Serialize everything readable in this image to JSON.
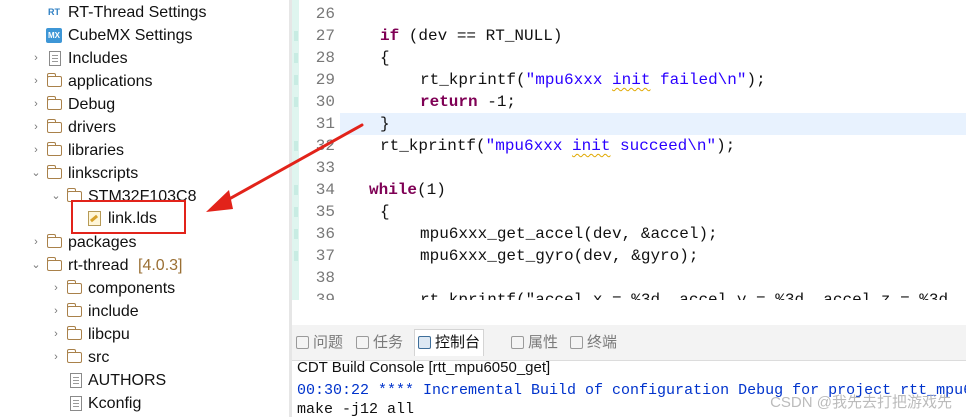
{
  "tree": {
    "rt_thread_settings": "RT-Thread Settings",
    "rt_icon_text": "RT",
    "cubemx_settings": "CubeMX Settings",
    "mx_icon_text": "MX",
    "includes": "Includes",
    "applications": "applications",
    "debug": "Debug",
    "drivers": "drivers",
    "libraries": "libraries",
    "linkscripts": "linkscripts",
    "stm32": "STM32F103C8",
    "link_lds": "link.lds",
    "packages": "packages",
    "rt_thread": "rt-thread",
    "rt_thread_version": "[4.0.3]",
    "components": "components",
    "include": "include",
    "libcpu": "libcpu",
    "src": "src",
    "authors": "AUTHORS",
    "kconfig": "Kconfig"
  },
  "editor": {
    "lines": [
      {
        "n": "26"
      },
      {
        "n": "27",
        "a": "if",
        "b": " (dev == RT_NULL)"
      },
      {
        "n": "28",
        "a": "{"
      },
      {
        "n": "29",
        "a": "rt_kprintf(",
        "s1": "\"mpu6xxx ",
        "s2": "init",
        "s3": " failed\\n\"",
        "b": ");"
      },
      {
        "n": "30",
        "a": "return",
        "b": " -1;"
      },
      {
        "n": "31",
        "a": "}"
      },
      {
        "n": "32",
        "a": "rt_kprintf(",
        "s1": "\"mpu6xxx ",
        "s2": "init",
        "s3": " succeed\\n\"",
        "b": ");"
      },
      {
        "n": "33"
      },
      {
        "n": "34",
        "a": "while",
        "b": "(1)"
      },
      {
        "n": "35",
        "a": "{"
      },
      {
        "n": "36",
        "a": "mpu6xxx_get_accel(dev, &accel);"
      },
      {
        "n": "37",
        "a": "mpu6xxx_get_gyro(dev, &gyro);"
      },
      {
        "n": "38"
      },
      {
        "n": "39",
        "a": "rt_kprintf(\"accel.x = %3d, accel.y = %3d, accel.z = %3d"
      }
    ],
    "scroll_left_arrow": "◀"
  },
  "panel": {
    "tabs": [
      "问题",
      "任务",
      "控制台",
      "属性",
      "终端"
    ],
    "console_title": "CDT Build Console [rtt_mpu6050_get]",
    "build_line": "00:30:22 **** Incremental Build of configuration Debug for project rtt_mpu6",
    "make_line": "make -j12 all",
    "watermark": "CSDN @我先去打把游戏先"
  },
  "colors": {
    "keyword": "#7f0055",
    "string": "#2a00ff",
    "console_blue": "#0033cc",
    "annotation_red": "#e2231a",
    "folder": "#a9814a"
  }
}
